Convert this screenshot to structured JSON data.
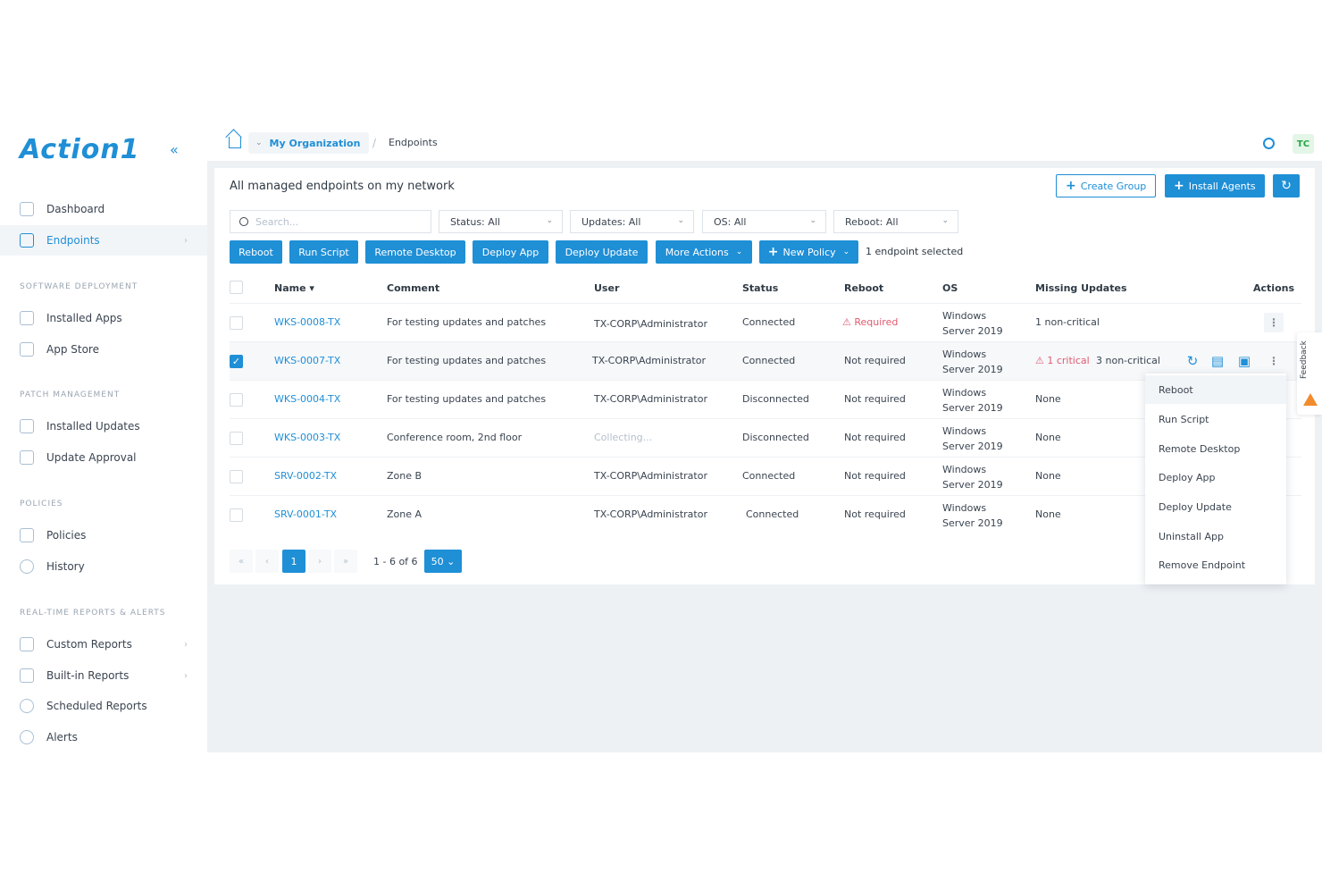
{
  "sidebar": {
    "logo": "Action1",
    "collapse_icon": "«",
    "items": [
      {
        "label": "Dashboard"
      },
      {
        "label": "Endpoints",
        "chevron": "›"
      }
    ],
    "sections": [
      {
        "title": "SOFTWARE DEPLOYMENT",
        "items": [
          {
            "label": "Installed Apps"
          },
          {
            "label": "App Store"
          }
        ]
      },
      {
        "title": "PATCH MANAGEMENT",
        "items": [
          {
            "label": "Installed Updates"
          },
          {
            "label": "Update Approval"
          }
        ]
      },
      {
        "title": "POLICIES",
        "items": [
          {
            "label": "Policies"
          },
          {
            "label": "History"
          }
        ]
      },
      {
        "title": "REAL-TIME REPORTS & ALERTS",
        "items": [
          {
            "label": "Custom Reports",
            "chevron": "›"
          },
          {
            "label": "Built-in Reports",
            "chevron": "›"
          },
          {
            "label": "Scheduled Reports"
          },
          {
            "label": "Alerts"
          }
        ]
      }
    ]
  },
  "topbar": {
    "org_chevron": "⌄",
    "org": "My Organization",
    "separator": "/",
    "current": "Endpoints",
    "avatar": "TC"
  },
  "panel": {
    "title": "All managed endpoints on my network",
    "create_group": "Create Group",
    "install_agents": "Install Agents",
    "plus": "+",
    "refresh_icon": "↻"
  },
  "filters": {
    "search_placeholder": "Search...",
    "dropdown_icon": "⌄",
    "status": "Status: All",
    "updates": "Updates: All",
    "os": "OS: All",
    "reboot": "Reboot: All"
  },
  "actions": {
    "reboot": "Reboot",
    "run_script": "Run Script",
    "remote_desktop": "Remote Desktop",
    "deploy_app": "Deploy App",
    "deploy_update": "Deploy Update",
    "more_actions": "More Actions",
    "new_policy": "New Policy",
    "selected_info": "1 endpoint selected"
  },
  "table": {
    "headers": {
      "name": "Name ▾",
      "comment": "Comment",
      "user": "User",
      "status": "Status",
      "reboot": "Reboot",
      "os": "OS",
      "missing": "Missing Updates",
      "actions": "Actions"
    },
    "checkmark": "✓",
    "kebab": "⋮",
    "rows": [
      {
        "name": "WKS-0008-TX",
        "comment": "For testing updates and patches",
        "user": "TX-CORP\\Administrator",
        "status": "Connected",
        "reboot": "⚠ Required",
        "os": "Windows Server 2019",
        "missing": "1 non-critical"
      },
      {
        "name": "WKS-0007-TX",
        "comment": "For testing updates and patches",
        "user": "TX-CORP\\Administrator",
        "status": "Connected",
        "reboot": "Not required",
        "os": "Windows Server 2019",
        "missing_critical": "⚠ 1 critical",
        "missing": "3 non-critical"
      },
      {
        "name": "WKS-0004-TX",
        "comment": "For testing updates and patches",
        "user": "TX-CORP\\Administrator",
        "status": "Disconnected",
        "reboot": "Not required",
        "os": "Windows Server 2019",
        "missing": "None"
      },
      {
        "name": "WKS-0003-TX",
        "comment": "Conference room, 2nd floor",
        "user": "Collecting...",
        "status": "Disconnected",
        "reboot": "Not required",
        "os": "Windows Server 2019",
        "missing": "None"
      },
      {
        "name": "SRV-0002-TX",
        "comment": "Zone B",
        "user": "TX-CORP\\Administrator",
        "status": "Connected",
        "reboot": "Not required",
        "os": "Windows Server 2019",
        "missing": "None"
      },
      {
        "name": "SRV-0001-TX",
        "comment": "Zone A",
        "user": "TX-CORP\\Administrator",
        "status": "Connected",
        "reboot": "Not required",
        "os": "Windows Server 2019",
        "missing": "None"
      }
    ],
    "row_icons": {
      "reboot": "↻",
      "script": "▤",
      "remote": "▣"
    }
  },
  "pagination": {
    "first": "«",
    "prev": "‹",
    "page": "1",
    "next": "›",
    "last": "»",
    "info": "1 - 6 of 6",
    "page_size": "50 ⌄"
  },
  "menu": {
    "items": [
      "Reboot",
      "Run Script",
      "Remote Desktop",
      "Deploy App",
      "Deploy Update",
      "Uninstall App",
      "Remove Endpoint"
    ]
  },
  "feedback": "Feedback",
  "colors": {
    "accent": "#1f8fd6",
    "warning": "#e05a6f",
    "feedback": "#f28b2c",
    "avatar": "#27a745"
  }
}
